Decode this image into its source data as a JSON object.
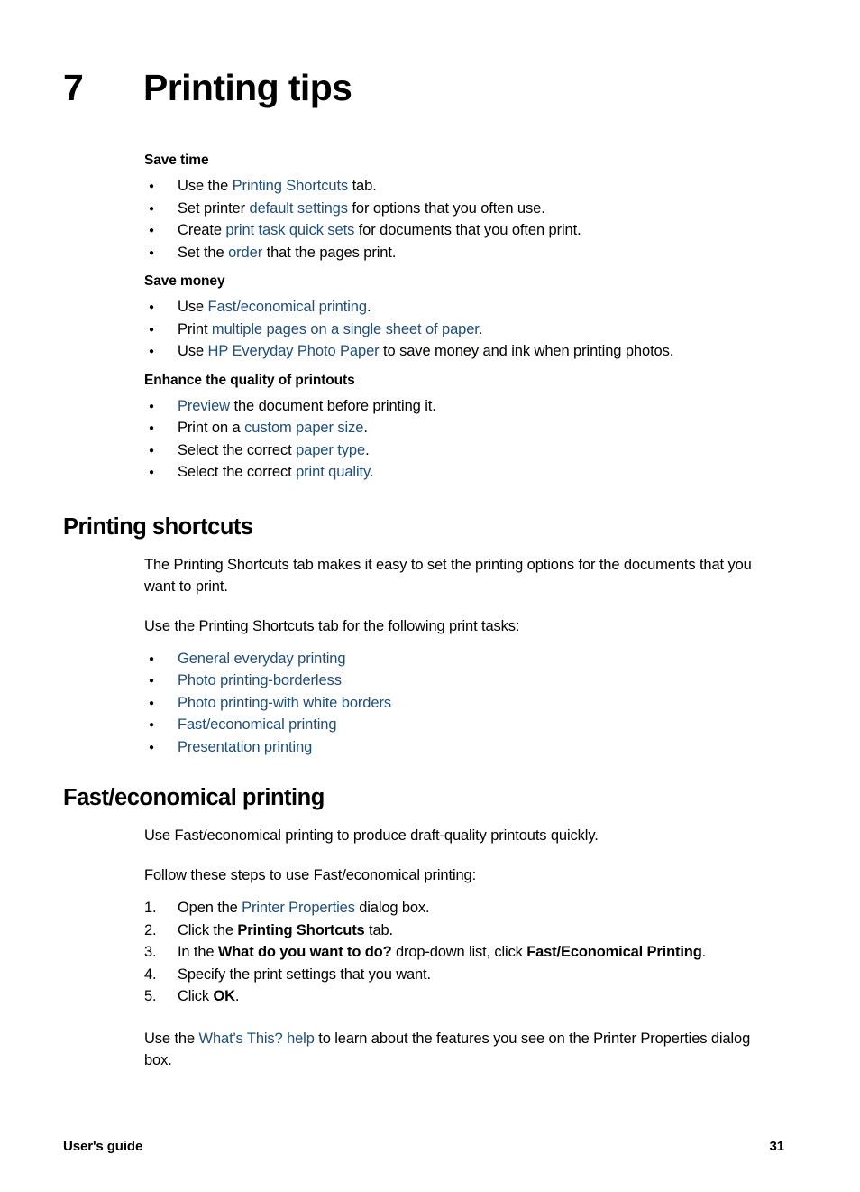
{
  "chapter": {
    "number": "7",
    "title": "Printing tips"
  },
  "tips": {
    "save_time": {
      "heading": "Save time",
      "items": [
        {
          "pre": "Use the ",
          "link": "Printing Shortcuts",
          "post": " tab."
        },
        {
          "pre": "Set printer ",
          "link": "default settings",
          "post": " for options that you often use."
        },
        {
          "pre": "Create ",
          "link": "print task quick sets",
          "post": " for documents that you often print."
        },
        {
          "pre": "Set the ",
          "link": "order",
          "post": " that the pages print."
        }
      ]
    },
    "save_money": {
      "heading": "Save money",
      "items": [
        {
          "pre": "Use ",
          "link": "Fast/economical printing",
          "post": "."
        },
        {
          "pre": "Print ",
          "link": "multiple pages on a single sheet of paper",
          "post": "."
        },
        {
          "pre": "Use ",
          "link": "HP Everyday Photo Paper",
          "post": " to save money and ink when printing photos."
        }
      ]
    },
    "enhance_quality": {
      "heading": "Enhance the quality of printouts",
      "items": [
        {
          "pre": "",
          "link": "Preview",
          "post": " the document before printing it."
        },
        {
          "pre": "Print on a ",
          "link": "custom paper size",
          "post": "."
        },
        {
          "pre": "Select the correct ",
          "link": "paper type",
          "post": "."
        },
        {
          "pre": "Select the correct ",
          "link": "print quality",
          "post": "."
        }
      ]
    }
  },
  "printing_shortcuts": {
    "heading": "Printing shortcuts",
    "paragraph_1": "The Printing Shortcuts tab makes it easy to set the printing options for the documents that you want to print.",
    "paragraph_2": "Use the Printing Shortcuts tab for the following print tasks:",
    "links": [
      "General everyday printing",
      "Photo printing-borderless",
      "Photo printing-with white borders",
      "Fast/economical printing",
      "Presentation printing"
    ]
  },
  "fast_economical": {
    "heading": "Fast/economical printing",
    "paragraph_1": "Use Fast/economical printing to produce draft-quality printouts quickly.",
    "paragraph_2": "Follow these steps to use Fast/economical printing:",
    "steps": [
      {
        "segments": [
          {
            "text": "Open the ",
            "style": "plain"
          },
          {
            "text": "Printer Properties",
            "style": "link"
          },
          {
            "text": " dialog box.",
            "style": "plain"
          }
        ]
      },
      {
        "segments": [
          {
            "text": "Click the ",
            "style": "plain"
          },
          {
            "text": "Printing Shortcuts",
            "style": "bold"
          },
          {
            "text": " tab.",
            "style": "plain"
          }
        ]
      },
      {
        "segments": [
          {
            "text": "In the ",
            "style": "plain"
          },
          {
            "text": "What do you want to do?",
            "style": "bold"
          },
          {
            "text": " drop-down list, click ",
            "style": "plain"
          },
          {
            "text": "Fast/Economical Printing",
            "style": "bold"
          },
          {
            "text": ".",
            "style": "plain"
          }
        ]
      },
      {
        "segments": [
          {
            "text": "Specify the print settings that you want.",
            "style": "plain"
          }
        ]
      },
      {
        "segments": [
          {
            "text": "Click ",
            "style": "plain"
          },
          {
            "text": "OK",
            "style": "bold"
          },
          {
            "text": ".",
            "style": "plain"
          }
        ]
      }
    ],
    "closing": {
      "pre": "Use the ",
      "link": "What's This? help",
      "post": " to learn about the features you see on the Printer Properties dialog box."
    }
  },
  "footer": {
    "left": "User's guide",
    "page_number": "31"
  },
  "colors": {
    "link": "#1F4E79",
    "text": "#000000",
    "background": "#FFFFFF"
  }
}
